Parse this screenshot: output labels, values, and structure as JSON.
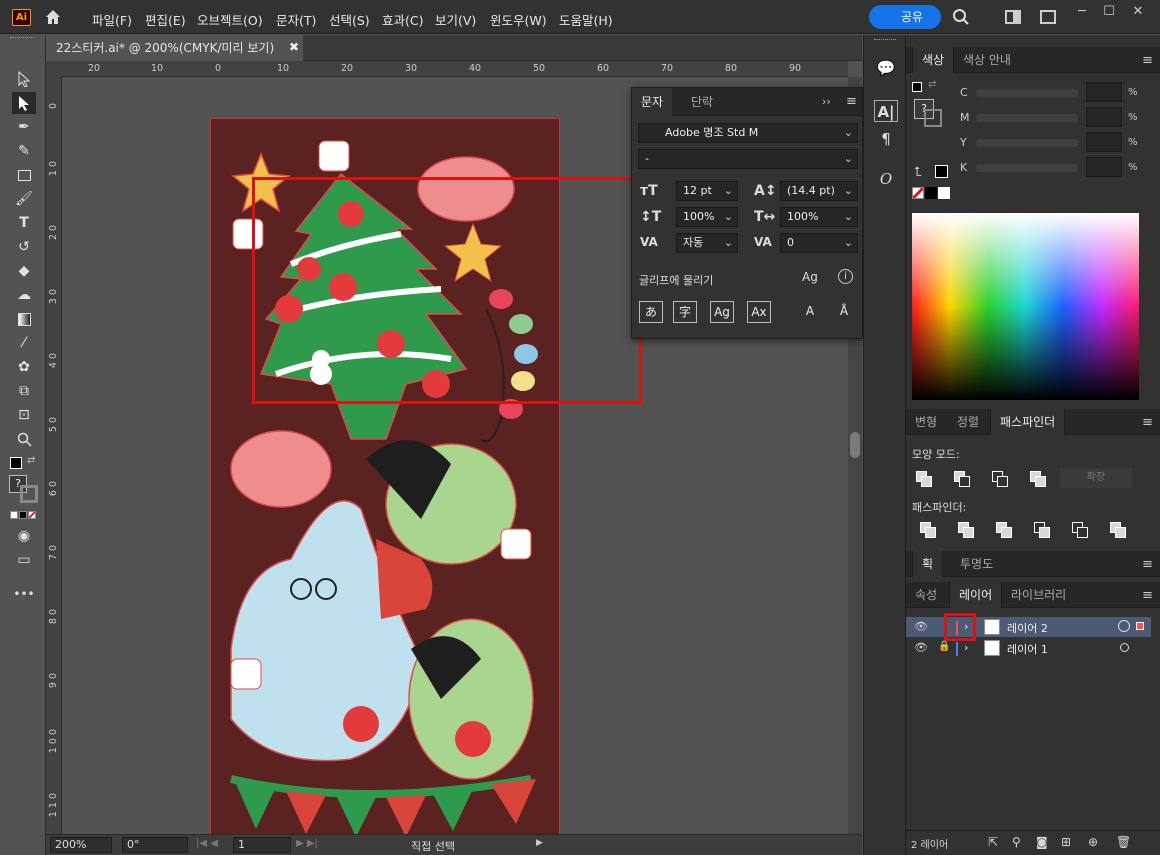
{
  "menubar": {
    "logo": "Ai",
    "items": [
      "파일(F)",
      "편집(E)",
      "오브젝트(O)",
      "문자(T)",
      "선택(S)",
      "효과(C)",
      "보기(V)",
      "윈도우(W)",
      "도움말(H)"
    ],
    "share_label": "공유"
  },
  "document": {
    "tab_title": "22스티커.ai* @ 200%(CMYK/미리 보기)"
  },
  "ruler": {
    "horizontal": [
      "20",
      "10",
      "0",
      "10",
      "20",
      "30",
      "40",
      "50",
      "60",
      "70",
      "80",
      "90"
    ],
    "vertical": [
      "0",
      "1\n0",
      "2\n0",
      "3\n0",
      "4\n0",
      "5\n0",
      "6\n0",
      "7\n0",
      "8\n0",
      "9\n0",
      "1\n0\n0",
      "1\n1\n0"
    ]
  },
  "status": {
    "zoom": "200%",
    "rotation": "0°",
    "artboard_number": "1",
    "tool_name": "직접 선택"
  },
  "character_panel": {
    "tabs": [
      "문자",
      "단락"
    ],
    "font_family": "Adobe 명조 Std M",
    "font_style": "-",
    "font_size": "12 pt",
    "leading": "(14.4 pt)",
    "vertical_scale": "100%",
    "horizontal_scale": "100%",
    "tracking": "자동",
    "kerning": "0",
    "snap_label": "글리프에 물리기",
    "glyph_buttons": [
      "あ",
      "字",
      "Ag",
      "Ax",
      "A",
      "Å"
    ]
  },
  "color_panel": {
    "tabs": [
      "색상",
      "색상 안내"
    ],
    "channels": [
      "C",
      "M",
      "Y",
      "K"
    ],
    "percent": "%"
  },
  "pathfinder_panel": {
    "tabs": [
      "변형",
      "정렬",
      "패스파인더"
    ],
    "shape_modes_label": "모양 모드:",
    "expand_label": "확장",
    "pathfinders_label": "패스파인더:"
  },
  "stroke_panel": {
    "tabs": [
      "획",
      "투명도"
    ]
  },
  "layers_panel": {
    "tabs": [
      "속성",
      "레이어",
      "라이브러리"
    ],
    "layers": [
      {
        "name": "레이어 2",
        "selected": true,
        "color": "#ff4d4d"
      },
      {
        "name": "레이어 1",
        "selected": false,
        "color": "#4d79ff"
      }
    ],
    "footer_count": "2 레이어"
  },
  "colors": {
    "accent": "#1473e6",
    "selection_red": "#e01010",
    "artboard_bg": "#5a2220"
  }
}
